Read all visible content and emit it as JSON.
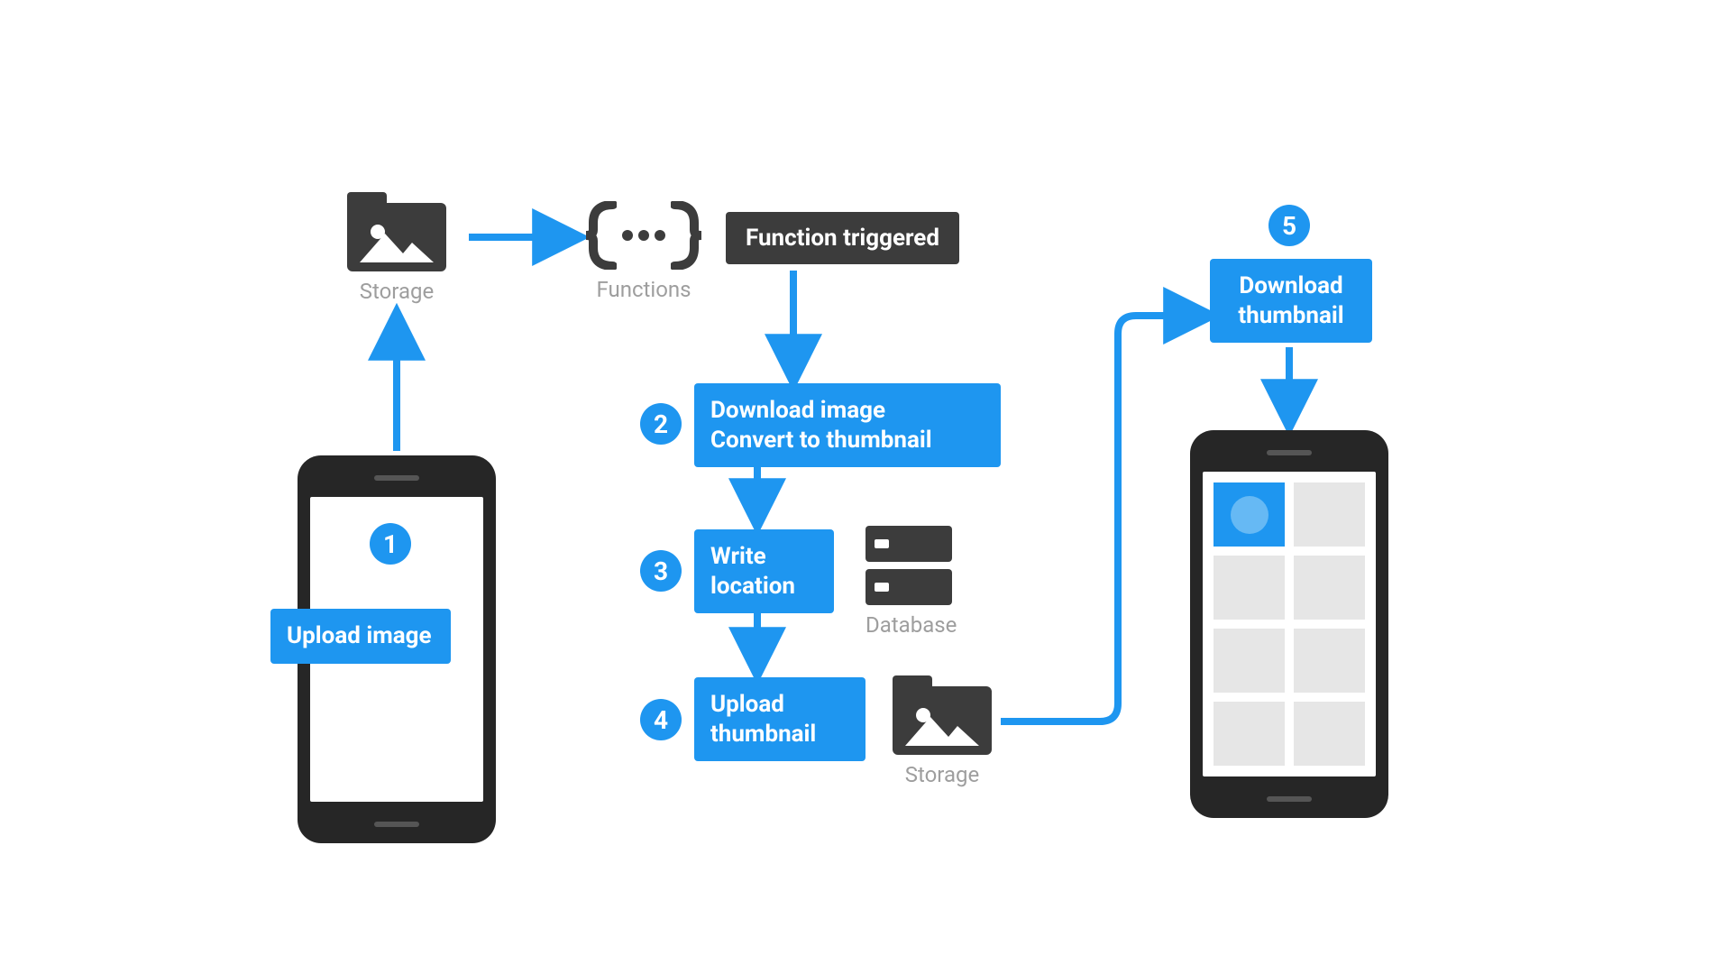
{
  "icons": {
    "storage_top_label": "Storage",
    "functions_label": "Functions",
    "database_label": "Database",
    "storage_bottom_label": "Storage"
  },
  "boxes": {
    "function_triggered": "Function triggered",
    "download_convert": "Download image\nConvert to thumbnail",
    "write_location": "Write\nlocation",
    "upload_thumbnail": "Upload\nthumbnail",
    "upload_image": "Upload\nimage",
    "download_thumbnail": "Download\nthumbnail"
  },
  "badges": {
    "n1": "1",
    "n2": "2",
    "n3": "3",
    "n4": "4",
    "n5": "5"
  },
  "colors": {
    "blue": "#1e96f0",
    "dark": "#3c3c3c",
    "grey_text": "#9e9e9e"
  }
}
